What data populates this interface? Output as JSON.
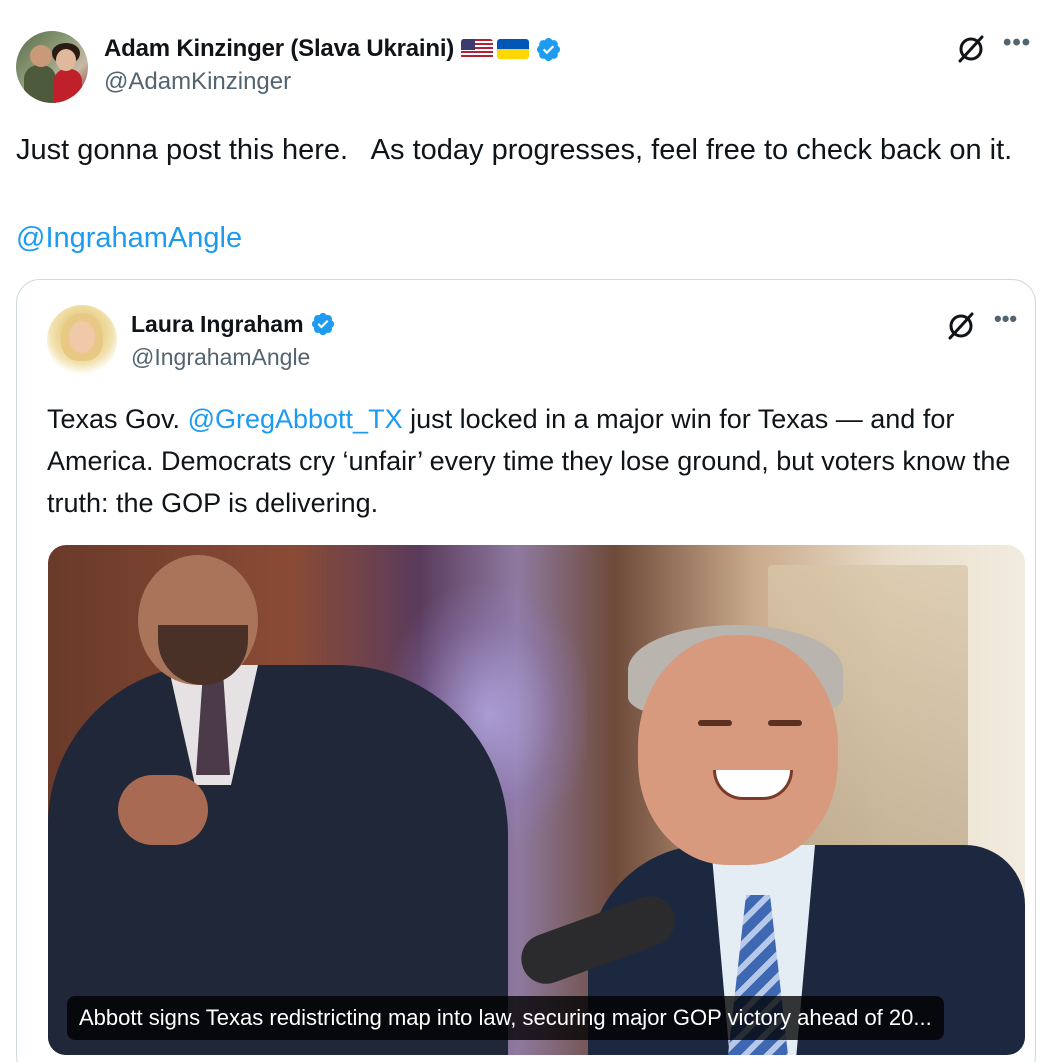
{
  "author": {
    "display_name": "Adam Kinzinger (Slava Ukraini)",
    "handle": "@AdamKinzinger",
    "flags": [
      "us-flag",
      "ukraine-flag"
    ],
    "verified": true
  },
  "post": {
    "text": "Just gonna post this here.   As today progresses, feel free to check back on it.",
    "mention": "@IngrahamAngle"
  },
  "quoted": {
    "display_name": "Laura Ingraham",
    "handle": "@IngrahamAngle",
    "verified": true,
    "text_before": "Texas Gov. ",
    "mention": "@GregAbbott_TX",
    "text_after": "  just locked in a major win for Texas — and for America. Democrats cry ‘unfair’ every time they lose ground, but voters know the truth: the GOP is delivering.",
    "media_caption": "Abbott signs Texas redistricting map into law, securing major GOP victory ahead of 20..."
  },
  "icons": {
    "grok": "grok-icon",
    "more": "more-icon",
    "verified": "verified-badge-icon"
  },
  "colors": {
    "link": "#1d9bf0",
    "verified": "#1d9bf0",
    "secondary_text": "#536471",
    "border": "#cfd9de"
  }
}
